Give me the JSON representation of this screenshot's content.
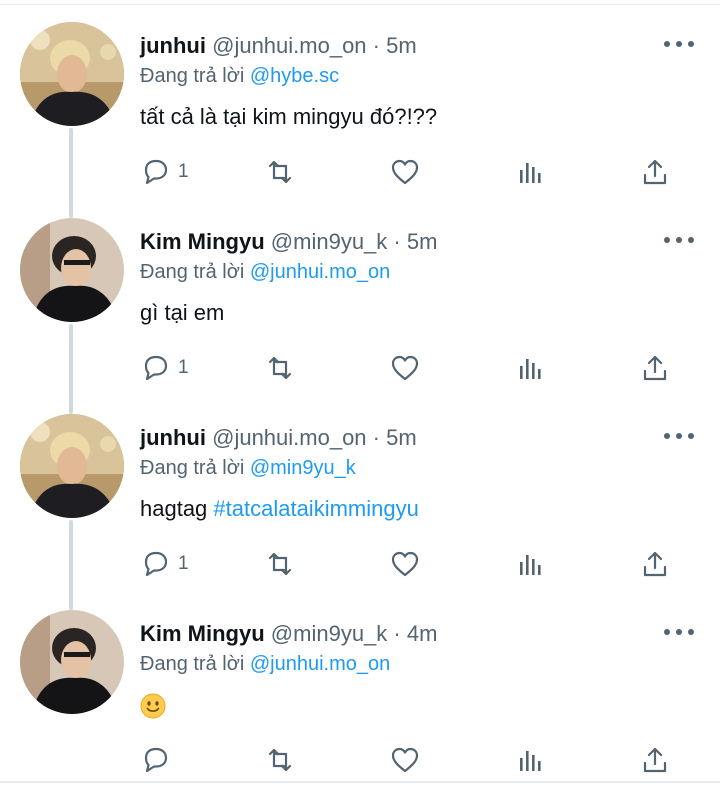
{
  "tweets": [
    {
      "name": "junhui",
      "handle": "@junhui.mo_on",
      "separator": "·",
      "time": "5m",
      "reply_prefix": "Đang trả lời",
      "reply_to": "@hybe.sc",
      "text": "tất cả là tại kim mingyu đó?!??",
      "reply_count": "1",
      "avatar": "avatar-blonde-man",
      "thread_continues": true
    },
    {
      "name": "Kim Mingyu",
      "handle": "@min9yu_k",
      "separator": "·",
      "time": "5m",
      "reply_prefix": "Đang trả lời",
      "reply_to": "@junhui.mo_on",
      "text": "gì tại em",
      "reply_count": "1",
      "avatar": "avatar-dark-haired-man",
      "thread_continues": true
    },
    {
      "name": "junhui",
      "handle": "@junhui.mo_on",
      "separator": "·",
      "time": "5m",
      "reply_prefix": "Đang trả lời",
      "reply_to": "@min9yu_k",
      "text_prefix": "hagtag ",
      "hashtag": "#tatcalataikimmingyu",
      "reply_count": "1",
      "avatar": "avatar-blonde-man",
      "thread_continues": true
    },
    {
      "name": "Kim Mingyu",
      "handle": "@min9yu_k",
      "separator": "·",
      "time": "4m",
      "reply_prefix": "Đang trả lời",
      "reply_to": "@junhui.mo_on",
      "emoji": "slightly-smiling-face",
      "reply_count": "",
      "avatar": "avatar-dark-haired-man",
      "thread_continues": false
    }
  ],
  "icons": {
    "reply": "reply-icon",
    "retweet": "retweet-icon",
    "like": "heart-icon",
    "views": "analytics-icon",
    "share": "share-icon",
    "more": "more-icon"
  },
  "colors": {
    "link": "#1d9bf0",
    "secondary": "#536471",
    "thread_line": "#cfd9de"
  }
}
